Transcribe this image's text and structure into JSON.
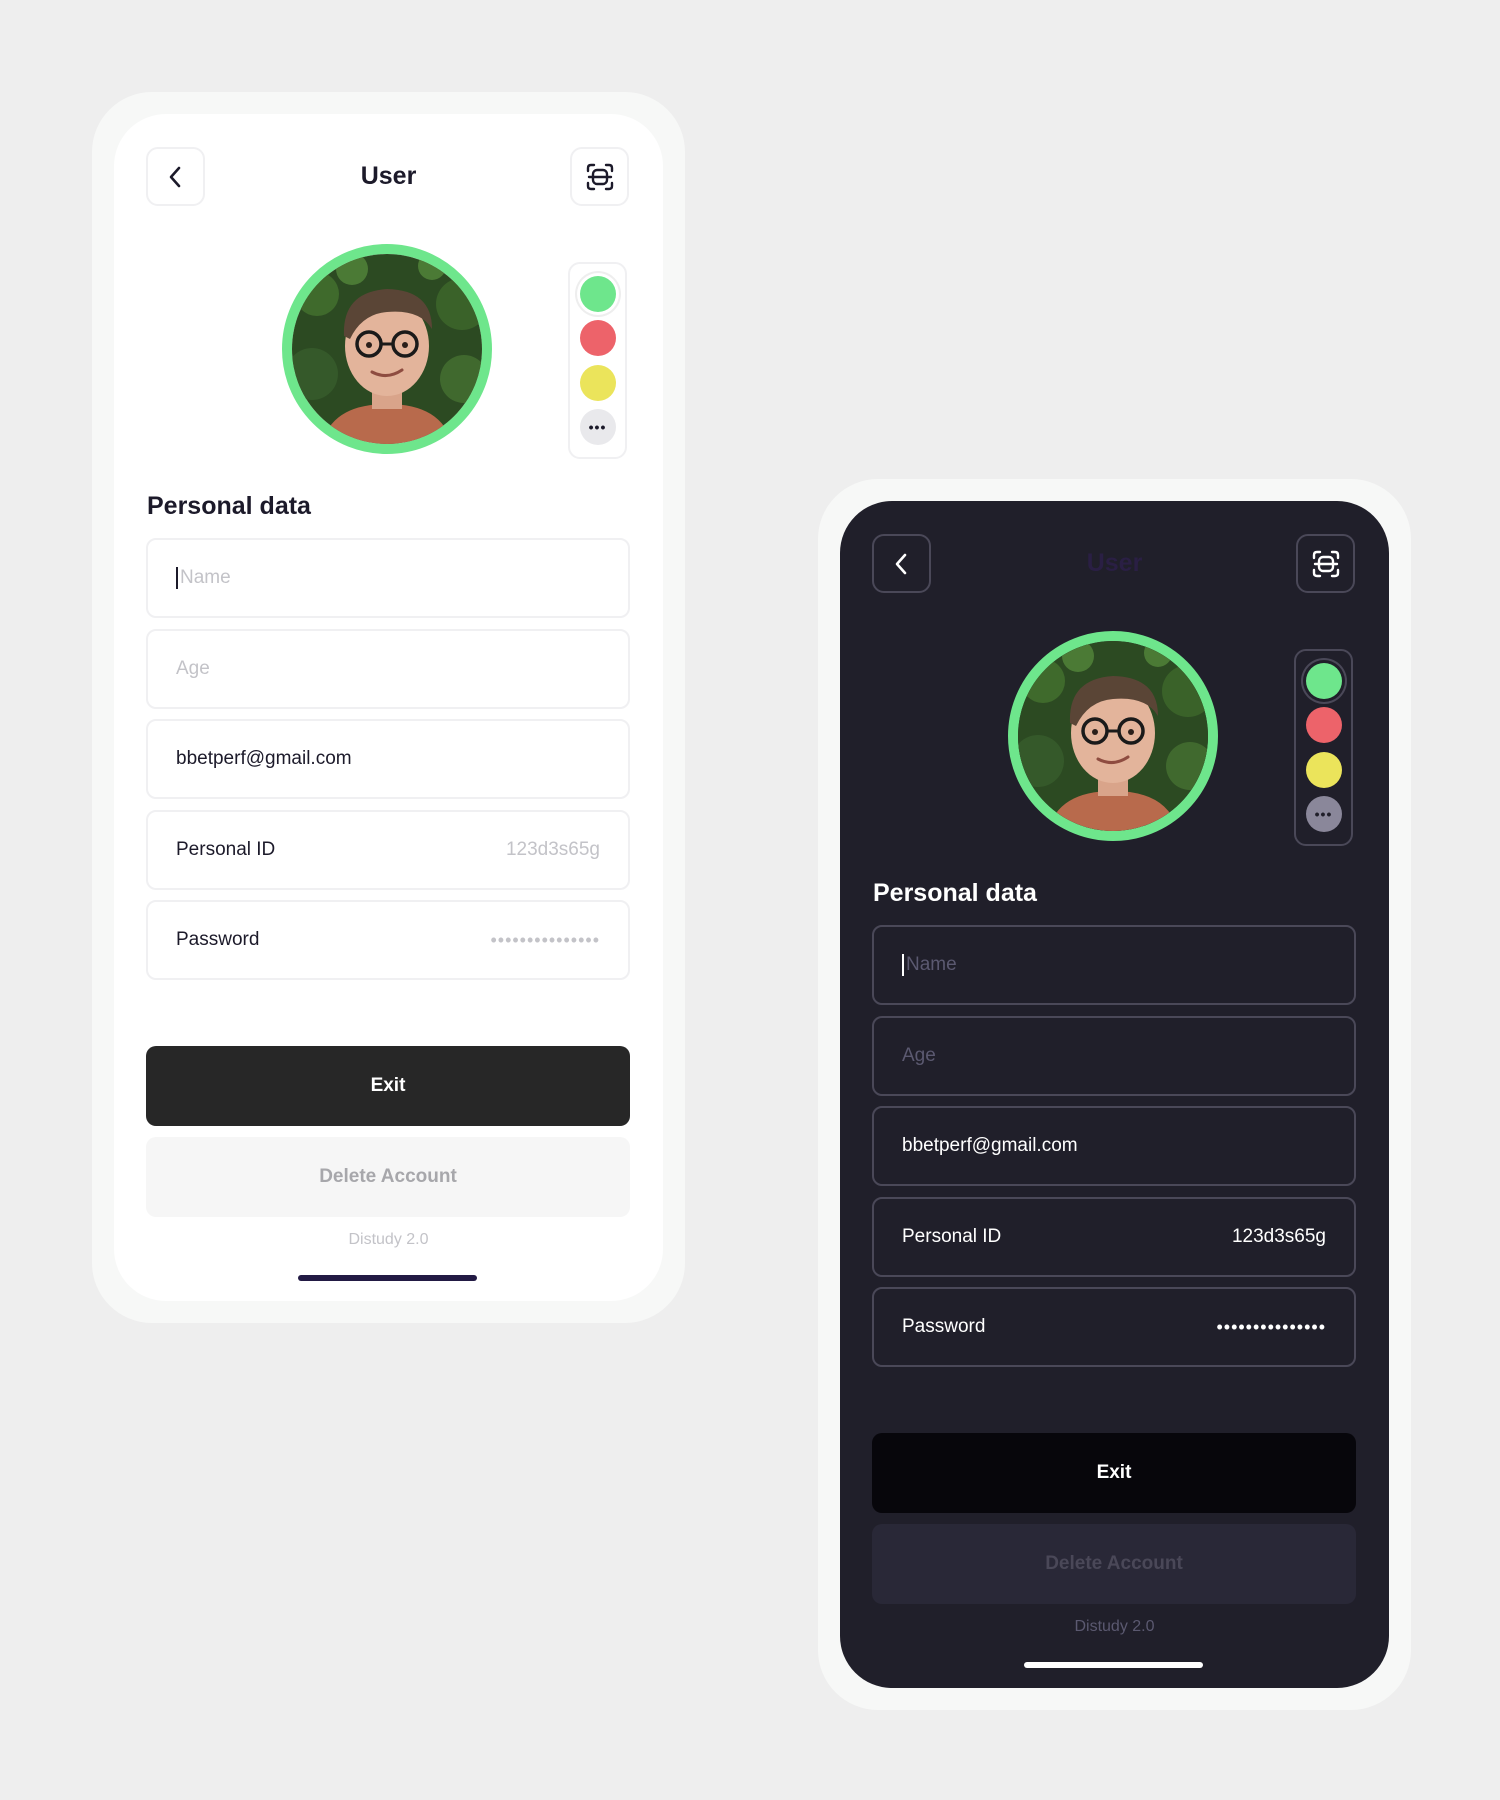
{
  "screens": [
    {
      "theme": "light",
      "header": {
        "title": "User"
      },
      "section_title": "Personal data",
      "fields": {
        "name_placeholder": "Name",
        "age_placeholder": "Age",
        "email": "bbetperf@gmail.com",
        "personal_id_label": "Personal ID",
        "personal_id_value": "123d3s65g",
        "password_label": "Password",
        "password_value": "•••••••••••••••"
      },
      "swatch_colors": [
        "#6ee68c",
        "#ed636a",
        "#ebe45b"
      ],
      "exit_label": "Exit",
      "delete_label": "Delete Account",
      "version": "Distudy 2.0"
    },
    {
      "theme": "dark",
      "header": {
        "title": "User"
      },
      "section_title": "Personal data",
      "fields": {
        "name_placeholder": "Name",
        "age_placeholder": "Age",
        "email": "bbetperf@gmail.com",
        "personal_id_label": "Personal ID",
        "personal_id_value": "123d3s65g",
        "password_label": "Password",
        "password_value": "•••••••••••••••"
      },
      "swatch_colors": [
        "#6ee68c",
        "#ed636a",
        "#ebe45b"
      ],
      "exit_label": "Exit",
      "delete_label": "Delete Account",
      "version": "Distudy 2.0"
    }
  ],
  "icons": {
    "back": "chevron-left-icon",
    "scan": "face-scan-icon",
    "more": "more-dots-icon"
  },
  "colors": {
    "accent_green": "#6ee68c",
    "red": "#ed636a",
    "yellow": "#ebe45b",
    "dark_bg": "#201f2a"
  }
}
